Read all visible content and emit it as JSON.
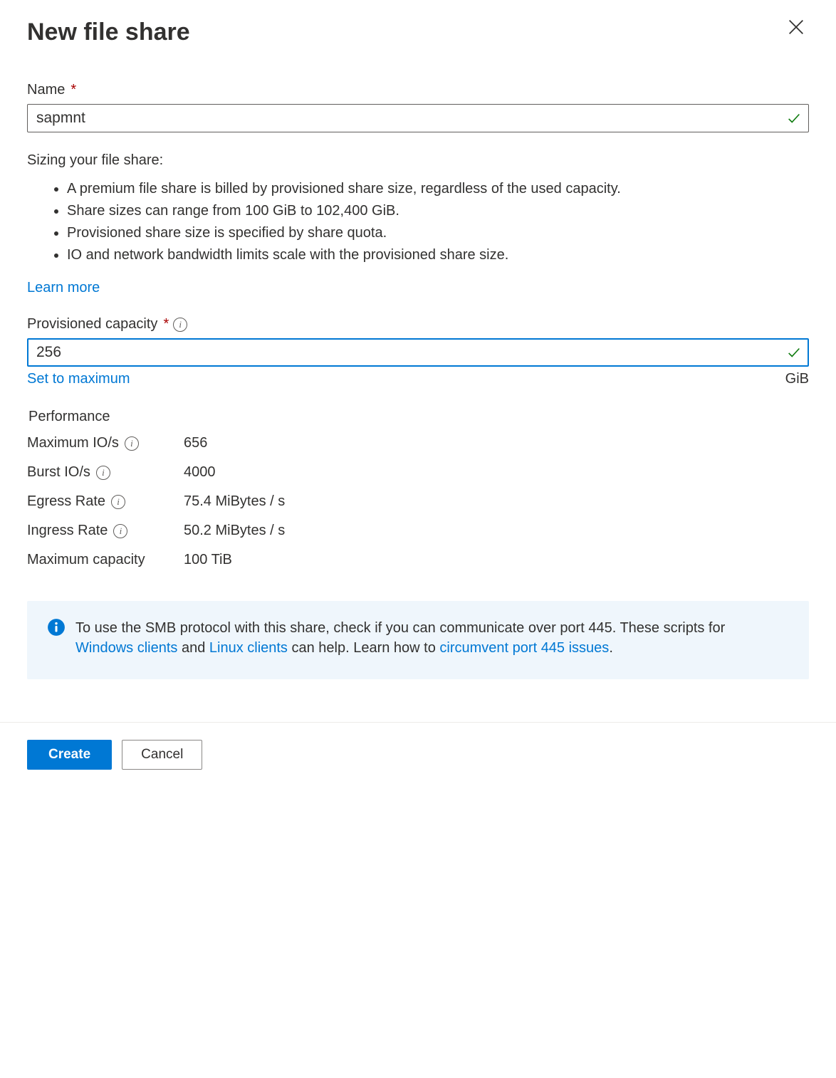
{
  "header": {
    "title": "New file share"
  },
  "name_field": {
    "label": "Name",
    "value": "sapmnt"
  },
  "sizing": {
    "heading": "Sizing your file share:",
    "bullets": [
      "A premium file share is billed by provisioned share size, regardless of the used capacity.",
      "Share sizes can range from 100 GiB to 102,400 GiB.",
      "Provisioned share size is specified by share quota.",
      "IO and network bandwidth limits scale with the provisioned share size."
    ],
    "learn_more": "Learn more"
  },
  "capacity": {
    "label": "Provisioned capacity",
    "value": "256",
    "set_max": "Set to maximum",
    "unit": "GiB"
  },
  "performance": {
    "heading": "Performance",
    "rows": [
      {
        "label": "Maximum IO/s",
        "value": "656",
        "info": true
      },
      {
        "label": "Burst IO/s",
        "value": "4000",
        "info": true
      },
      {
        "label": "Egress Rate",
        "value": "75.4 MiBytes / s",
        "info": true
      },
      {
        "label": "Ingress Rate",
        "value": "50.2 MiBytes / s",
        "info": true
      },
      {
        "label": "Maximum capacity",
        "value": "100 TiB",
        "info": false
      }
    ]
  },
  "notice": {
    "t1": "To use the SMB protocol with this share, check if you can communicate over port 445. These scripts for ",
    "l1": "Windows clients",
    "t2": " and ",
    "l2": "Linux clients",
    "t3": " can help. Learn how to ",
    "l3": "circumvent port 445 issues",
    "t4": "."
  },
  "footer": {
    "create": "Create",
    "cancel": "Cancel"
  }
}
